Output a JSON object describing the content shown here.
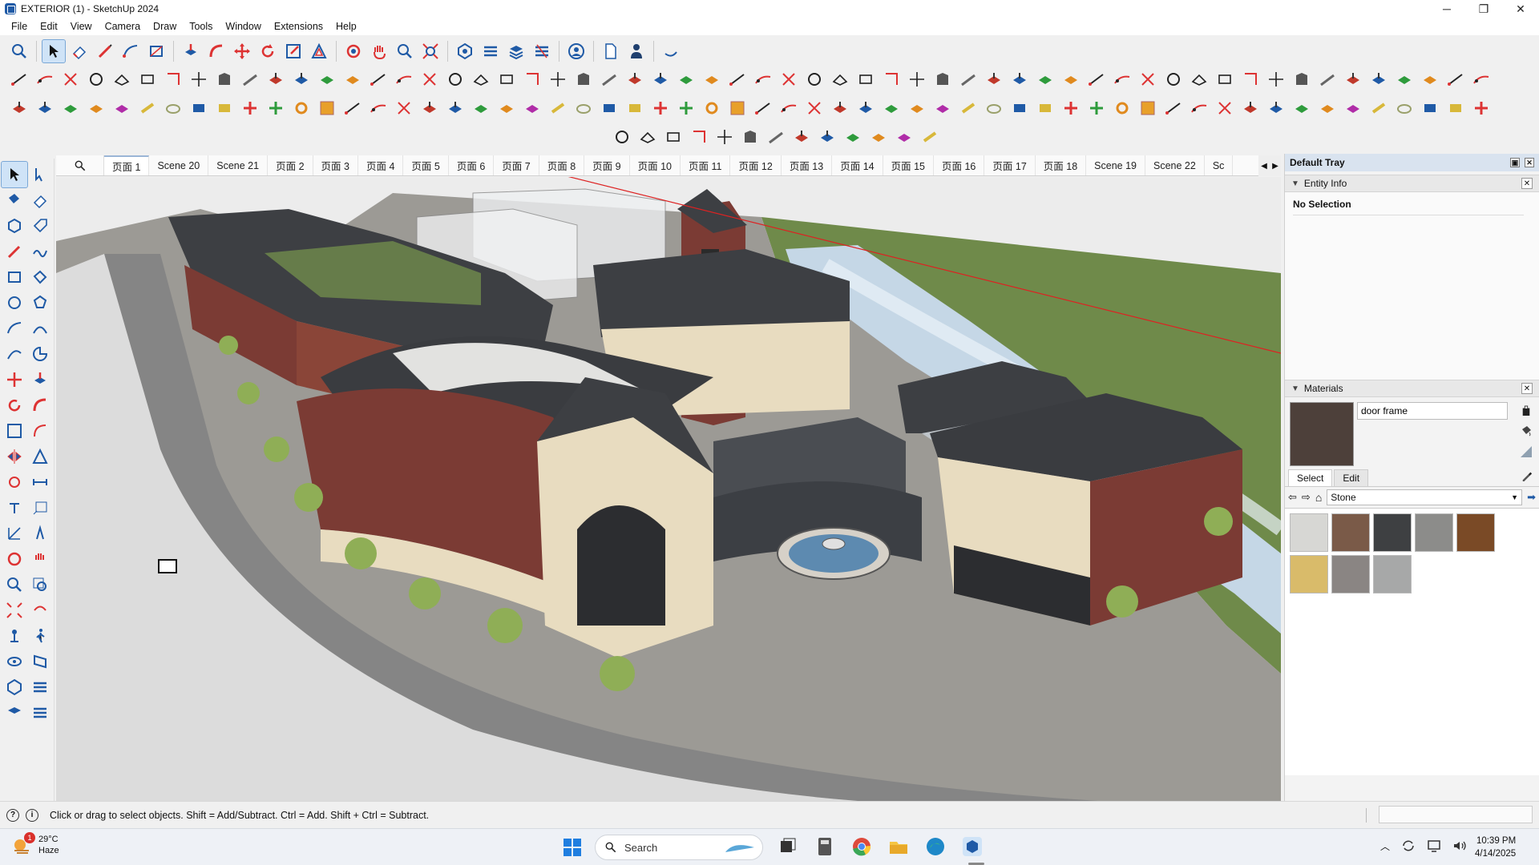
{
  "window": {
    "title": "EXTERIOR  (1) - SketchUp 2024",
    "controls": {
      "minimize": "─",
      "maximize": "❐",
      "close": "✕"
    }
  },
  "menu": [
    "File",
    "Edit",
    "View",
    "Camera",
    "Draw",
    "Tools",
    "Window",
    "Extensions",
    "Help"
  ],
  "scenes": {
    "active_index": 0,
    "tabs": [
      "页面 1",
      "Scene 20",
      "Scene 21",
      "页面 2",
      "页面 3",
      "页面 4",
      "页面 5",
      "页面 6",
      "页面 7",
      "页面 8",
      "页面 9",
      "页面 10",
      "页面 11",
      "页面 12",
      "页面 13",
      "页面 14",
      "页面 15",
      "页面 16",
      "页面 17",
      "页面 18",
      "Scene 19",
      "Scene 22",
      "Sc"
    ]
  },
  "tray": {
    "title": "Default Tray",
    "entity_info": {
      "header": "Entity Info",
      "value": "No Selection"
    },
    "materials": {
      "header": "Materials",
      "current_name": "door frame",
      "current_color": "#4d403a",
      "tabs": [
        "Select",
        "Edit"
      ],
      "active_tab": "Select",
      "library": "Stone",
      "swatches": [
        "#d7d7d4",
        "#7a5a48",
        "#3e4042",
        "#8c8c8a",
        "#7a4a26",
        "#d9bb6a",
        "#8a8583",
        "#a7a8a8"
      ]
    }
  },
  "statusbar": {
    "hint": "Click or drag to select objects. Shift = Add/Subtract. Ctrl = Add. Shift + Ctrl = Subtract."
  },
  "taskbar": {
    "weather_temp": "29°C",
    "weather_desc": "Haze",
    "weather_badge": "1",
    "search_placeholder": "Search",
    "time": "10:39 PM",
    "date": "4/14/2025"
  },
  "colors": {
    "accent": "#1f5aa6",
    "roof": "#3d3f43",
    "brick": "#7b3b34",
    "stone": "#e8dcc0",
    "grass": "#6f8a4a",
    "water": "#c5d7e6",
    "road": "#8a8a8a",
    "plaza": "#9c9a95"
  }
}
